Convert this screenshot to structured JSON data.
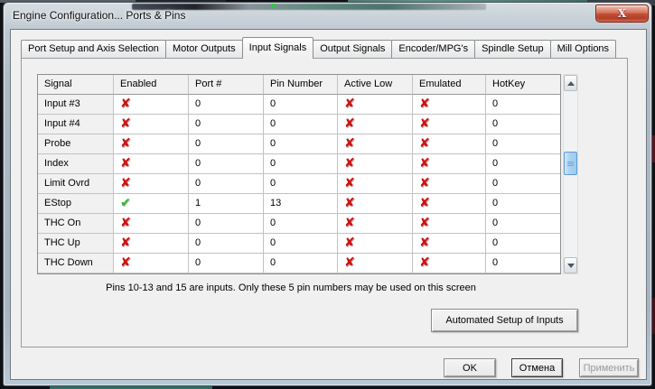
{
  "window": {
    "title": "Engine Configuration... Ports & Pins",
    "close_glyph": "X"
  },
  "tabs": [
    {
      "label": "Port Setup and Axis Selection",
      "active": false
    },
    {
      "label": "Motor Outputs",
      "active": false
    },
    {
      "label": "Input Signals",
      "active": true
    },
    {
      "label": "Output Signals",
      "active": false
    },
    {
      "label": "Encoder/MPG's",
      "active": false
    },
    {
      "label": "Spindle Setup",
      "active": false
    },
    {
      "label": "Mill Options",
      "active": false
    }
  ],
  "table": {
    "columns": [
      "Signal",
      "Enabled",
      "Port #",
      "Pin Number",
      "Active Low",
      "Emulated",
      "HotKey"
    ],
    "rows": [
      {
        "signal": "Input #3",
        "enabled": "cross",
        "port": "0",
        "pin": "0",
        "active_low": "cross",
        "emulated": "cross",
        "hotkey": "0"
      },
      {
        "signal": "Input #4",
        "enabled": "cross",
        "port": "0",
        "pin": "0",
        "active_low": "cross",
        "emulated": "cross",
        "hotkey": "0"
      },
      {
        "signal": "Probe",
        "enabled": "cross",
        "port": "0",
        "pin": "0",
        "active_low": "cross",
        "emulated": "cross",
        "hotkey": "0"
      },
      {
        "signal": "Index",
        "enabled": "cross",
        "port": "0",
        "pin": "0",
        "active_low": "cross",
        "emulated": "cross",
        "hotkey": "0"
      },
      {
        "signal": "Limit Ovrd",
        "enabled": "cross",
        "port": "0",
        "pin": "0",
        "active_low": "cross",
        "emulated": "cross",
        "hotkey": "0"
      },
      {
        "signal": "EStop",
        "enabled": "check",
        "port": "1",
        "pin": "13",
        "active_low": "cross",
        "emulated": "cross",
        "hotkey": "0"
      },
      {
        "signal": "THC On",
        "enabled": "cross",
        "port": "0",
        "pin": "0",
        "active_low": "cross",
        "emulated": "cross",
        "hotkey": "0"
      },
      {
        "signal": "THC Up",
        "enabled": "cross",
        "port": "0",
        "pin": "0",
        "active_low": "cross",
        "emulated": "cross",
        "hotkey": "0"
      },
      {
        "signal": "THC Down",
        "enabled": "cross",
        "port": "0",
        "pin": "0",
        "active_low": "cross",
        "emulated": "cross",
        "hotkey": "0"
      }
    ]
  },
  "icons": {
    "cross_glyph": "✘",
    "check_glyph": "✔"
  },
  "note": "Pins 10-13 and 15 are inputs. Only these 5 pin numbers may be used on this screen",
  "buttons": {
    "automated_setup": "Automated Setup of Inputs",
    "ok": "OK",
    "cancel": "Отмена",
    "apply": "Применить"
  },
  "colors": {
    "cross": "#cf1110",
    "check": "#2fb32f",
    "close_button_red": "#c24f35",
    "scroll_thumb_blue": "#aad3f1",
    "dialog_bg": "#f0f0f0"
  }
}
